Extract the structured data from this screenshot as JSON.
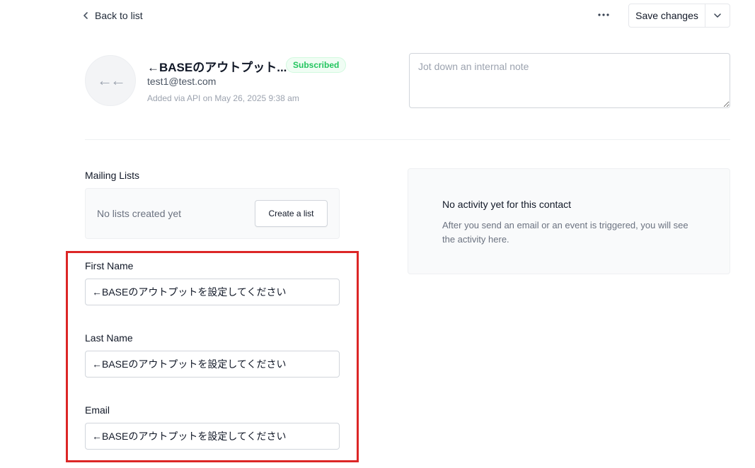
{
  "header": {
    "back_label": "Back to list",
    "save_label": "Save changes"
  },
  "contact": {
    "avatar_glyph": "←←",
    "name": "←BASEのアウトプット...",
    "status": "Subscribed",
    "email": "test1@test.com",
    "meta": "Added via API on May 26, 2025 9:38 am"
  },
  "note": {
    "placeholder": "Jot down an internal note",
    "value": ""
  },
  "mailing_lists": {
    "label": "Mailing Lists",
    "empty_text": "No lists created yet",
    "create_label": "Create a list"
  },
  "activity": {
    "title": "No activity yet for this contact",
    "description": "After you send an email or an event is triggered, you will see the activity here."
  },
  "fields": {
    "first_name": {
      "label": "First Name",
      "value": "←BASEのアウトプットを設定してください"
    },
    "last_name": {
      "label": "Last Name",
      "value": "←BASEのアウトプットを設定してください"
    },
    "email": {
      "label": "Email",
      "value": "←BASEのアウトプットを設定してください"
    }
  },
  "colors": {
    "accent_green": "#22c55e",
    "highlight_red": "#dc2626"
  },
  "icons": {
    "back": "chevron-left-icon",
    "more": "more-horizontal-icon",
    "caret": "chevron-down-icon"
  }
}
